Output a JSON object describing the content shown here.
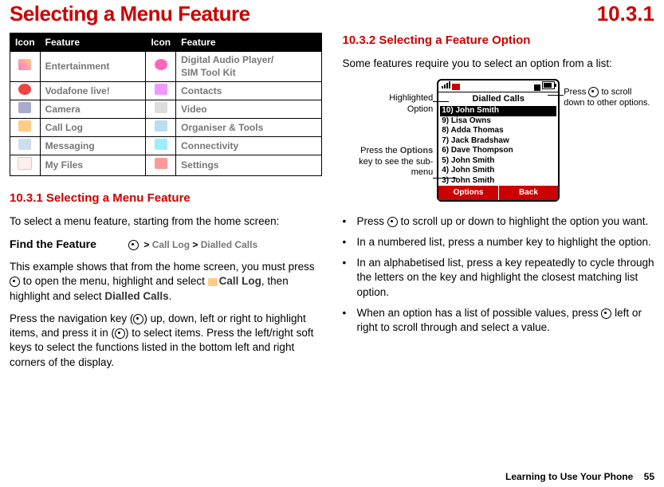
{
  "header": {
    "title": "Selecting a Menu Feature",
    "section_number": "10.3.1"
  },
  "table": {
    "h1": "Icon",
    "h2": "Feature",
    "h3": "Icon",
    "h4": "Feature",
    "rows": [
      {
        "f1": "Entertainment",
        "f2": "Digital Audio Player/\nSIM Tool Kit"
      },
      {
        "f1": "Vodafone live!",
        "f2": "Contacts"
      },
      {
        "f1": "Camera",
        "f2": "Video"
      },
      {
        "f1": "Call Log",
        "f2": "Organiser & Tools"
      },
      {
        "f1": "Messaging",
        "f2": "Connectivity"
      },
      {
        "f1": "My Files",
        "f2": "Settings"
      }
    ]
  },
  "left": {
    "sub1": "10.3.1 Selecting a Menu Feature",
    "p1": "To select a menu feature, starting from the home screen:",
    "ftf_label": "Find the Feature",
    "ftf_path_1": "Call Log",
    "ftf_path_2": "Dialled Calls",
    "p2a": "This example shows that from the home screen, you must press ",
    "p2b": " to open the menu, highlight and select ",
    "p2_bold1": "Call Log",
    "p2c": ", then highlight and select ",
    "p2_bold2": "Dialled Calls",
    "p2d": ".",
    "p3a": "Press the navigation key (",
    "p3b": ") up, down, left or right to highlight items, and press it in (",
    "p3c": ") to select items. Press the left/right soft keys to select the functions listed in the bottom left and right corners of the display."
  },
  "right": {
    "sub2": "10.3.2 Selecting a Feature Option",
    "p1": "Some features require you to select an option from a list:",
    "anno_hl": "Highlighted\nOption",
    "anno_opt_a": "Press the ",
    "anno_opt_bold": "Options",
    "anno_opt_b": " key to see the sub-menu",
    "anno_scroll_a": "Press ",
    "anno_scroll_b": " to scroll down to other options.",
    "phone": {
      "title": "Dialled Calls",
      "list": [
        "10) John Smith",
        "9) Lisa Owns",
        "8) Adda Thomas",
        "7) Jack Bradshaw",
        "6) Dave Thompson",
        "5) John Smith",
        "4) John Smith",
        "3) John Smith"
      ],
      "soft_left": "Options",
      "soft_right": "Back"
    },
    "b1a": "Press ",
    "b1b": " to scroll up or down to highlight the option you want.",
    "b2": "In a numbered list, press a number key to highlight the option.",
    "b3": "In an alphabetised list, press a key repeatedly to cycle through the letters on the key and highlight the closest matching list option.",
    "b4a": "When an option has a list of possible values, press ",
    "b4b": " left or right to scroll through and select a value."
  },
  "footer": {
    "section": "Learning to Use Your Phone",
    "page": "55"
  }
}
